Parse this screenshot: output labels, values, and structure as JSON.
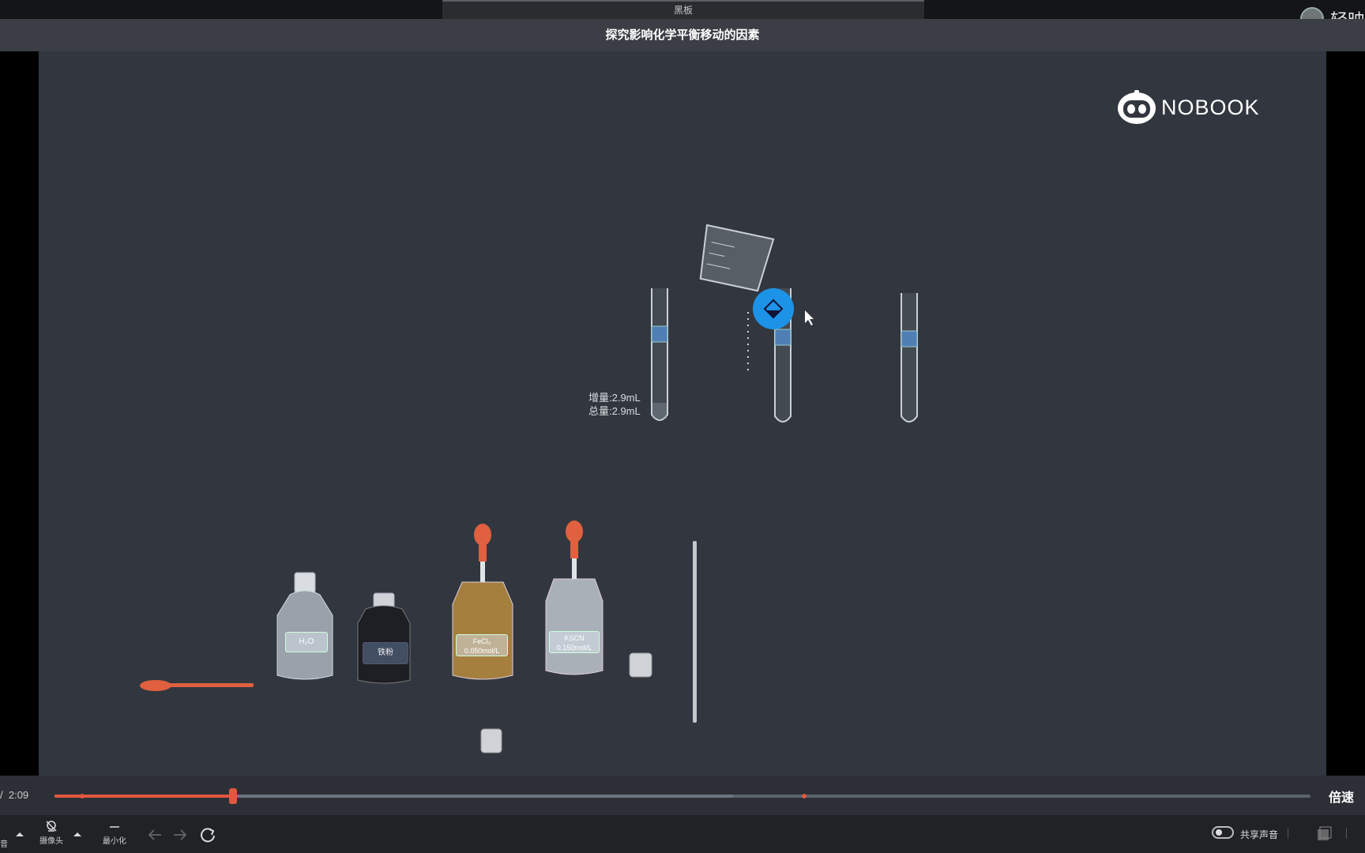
{
  "window": {
    "tab_title": "黑板",
    "brand_text": "轻映"
  },
  "page_title": "探究影响化学平衡移动的因素",
  "logo": {
    "text": "NOBOOK"
  },
  "measurement": {
    "increment": "增量:2.9mL",
    "total": "总量:2.9mL"
  },
  "reagents": [
    {
      "label": "H₂O",
      "color": "#b7bcc4"
    },
    {
      "label": "铁粉",
      "color": "#1e1f24"
    },
    {
      "label": "FeCl₃ 0.050mol/L",
      "color": "#b08a44"
    },
    {
      "label": "KSCN 0.150mol/L",
      "color": "#b9bcc1"
    }
  ],
  "player": {
    "current_time_prefix": "/",
    "total_time": "2:09",
    "progress": 0.142,
    "buffered": 0.54,
    "markers": [
      0.022,
      0.597
    ],
    "speed_label": "倍速",
    "accent": "#e2573f"
  },
  "bottom": {
    "camera_label": "摄像头",
    "minimize_label": "最小化",
    "share_audio_label": "共享声音",
    "first_label_fragment": "音"
  }
}
